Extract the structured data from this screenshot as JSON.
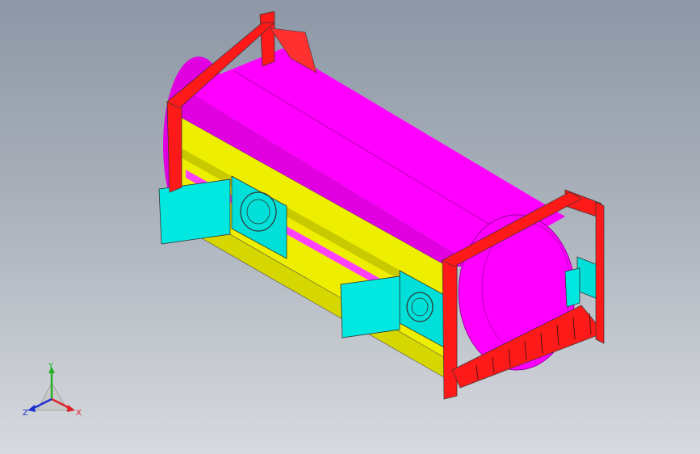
{
  "axis_triad": {
    "y_label": "Y",
    "z_label": "Z",
    "x_label": "X",
    "colors": {
      "x": "#e0202a",
      "y": "#20b020",
      "z": "#2030d0"
    }
  },
  "model_colors": {
    "frame": "#ff1a1a",
    "tank_shell": "#ff00ff",
    "tank_shade": "#c800c8",
    "walkway": "#eeee00",
    "hatch_panel": "#00e8e0",
    "background_top": "#8d97a6",
    "background_bottom": "#d7dade"
  }
}
